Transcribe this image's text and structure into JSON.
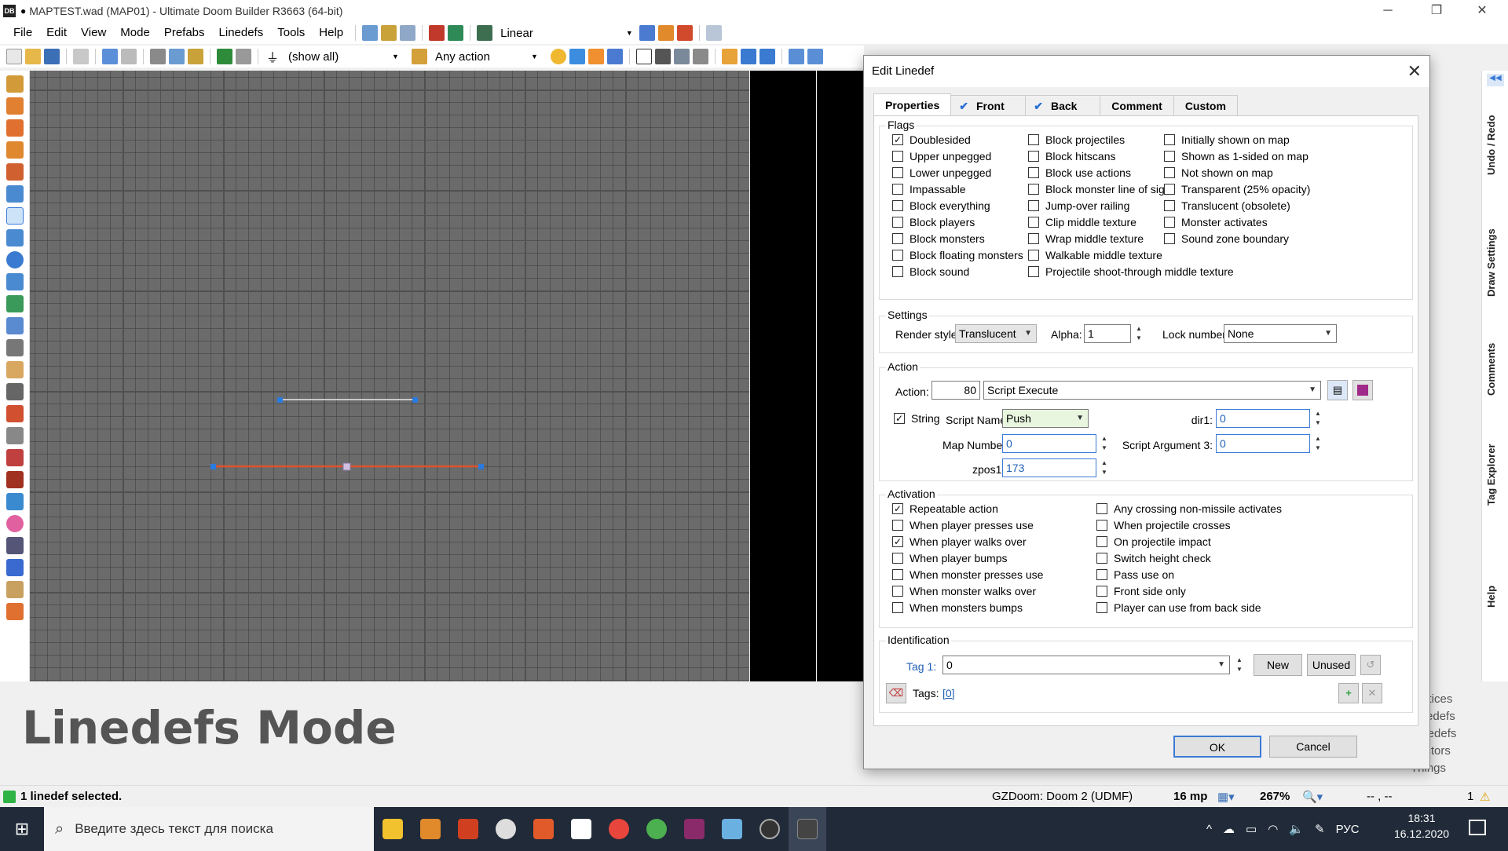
{
  "window": {
    "title": "MAPTEST.wad (MAP01) - Ultimate Doom Builder R3663 (64-bit)",
    "app_icon": "DB",
    "unsaved_marker": "●"
  },
  "menu": [
    "File",
    "Edit",
    "View",
    "Mode",
    "Prefabs",
    "Linedefs",
    "Tools",
    "Help"
  ],
  "menu_right": {
    "linear": "Linear"
  },
  "toolbar": {
    "filter": "(show all)",
    "action_filter": "Any action"
  },
  "mode_label": "Linedefs Mode",
  "side_list": [
    "Vertices",
    "Linedefs",
    "Sidedefs",
    "Sectors",
    "Things"
  ],
  "right_tabs": [
    "Undo / Redo",
    "Draw Settings",
    "Comments",
    "Tag Explorer",
    "Help"
  ],
  "status": {
    "message": "1 linedef selected.",
    "engine": "GZDoom: Doom 2 (UDMF)",
    "grid": "16 mp",
    "zoom": "267%",
    "coords": "-- , --",
    "count": "1"
  },
  "taskbar": {
    "search_placeholder": "Введите здесь текст для поиска",
    "lang": "РУС",
    "time": "18:31",
    "date": "16.12.2020"
  },
  "dialog": {
    "title": "Edit Linedef",
    "tabs": [
      {
        "label": "Properties",
        "checked": false
      },
      {
        "label": "Front",
        "checked": true
      },
      {
        "label": "Back",
        "checked": true
      },
      {
        "label": "Comment",
        "checked": false
      },
      {
        "label": "Custom",
        "checked": false
      }
    ],
    "flags_title": "Flags",
    "flags": [
      [
        {
          "label": "Doublesided",
          "checked": true
        },
        {
          "label": "Upper unpegged",
          "checked": false
        },
        {
          "label": "Lower unpegged",
          "checked": false
        },
        {
          "label": "Impassable",
          "checked": false
        },
        {
          "label": "Block everything",
          "checked": false
        },
        {
          "label": "Block players",
          "checked": false
        },
        {
          "label": "Block monsters",
          "checked": false
        },
        {
          "label": "Block floating monsters",
          "checked": false
        },
        {
          "label": "Block sound",
          "checked": false
        }
      ],
      [
        {
          "label": "Block projectiles",
          "checked": false
        },
        {
          "label": "Block hitscans",
          "checked": false
        },
        {
          "label": "Block use actions",
          "checked": false
        },
        {
          "label": "Block monster line of sight",
          "checked": false
        },
        {
          "label": "Jump-over railing",
          "checked": false
        },
        {
          "label": "Clip middle texture",
          "checked": false
        },
        {
          "label": "Wrap middle texture",
          "checked": false
        },
        {
          "label": "Walkable middle texture",
          "checked": false
        },
        {
          "label": "Projectile shoot-through middle texture",
          "checked": false
        }
      ],
      [
        {
          "label": "Initially shown on map",
          "checked": false
        },
        {
          "label": "Shown as 1-sided on map",
          "checked": false
        },
        {
          "label": "Not shown on map",
          "checked": false
        },
        {
          "label": "Transparent (25% opacity)",
          "checked": false
        },
        {
          "label": "Translucent (obsolete)",
          "checked": false
        },
        {
          "label": "Monster activates",
          "checked": false
        },
        {
          "label": "Sound zone boundary",
          "checked": false
        }
      ]
    ],
    "settings": {
      "title": "Settings",
      "render_style_label": "Render style:",
      "render_style": "Translucent",
      "alpha_label": "Alpha:",
      "alpha": "1",
      "lock_label": "Lock number:",
      "lock": "None"
    },
    "action": {
      "title": "Action",
      "action_label": "Action:",
      "number": "80",
      "name": "Script Execute",
      "string_label": "String",
      "string_checked": true,
      "script_name_label": "Script Name:",
      "script_name": "Push",
      "map_number_label": "Map Number:",
      "map_number": "0",
      "zpos1_label": "zpos1:",
      "zpos1": "173",
      "dir1_label": "dir1:",
      "dir1": "0",
      "arg3_label": "Script Argument 3:",
      "arg3": "0"
    },
    "activation_title": "Activation",
    "activation": [
      [
        {
          "label": "Repeatable action",
          "checked": true
        },
        {
          "label": "When player presses use",
          "checked": false
        },
        {
          "label": "When player walks over",
          "checked": true
        },
        {
          "label": "When player bumps",
          "checked": false
        },
        {
          "label": "When monster presses use",
          "checked": false
        },
        {
          "label": "When monster walks over",
          "checked": false
        },
        {
          "label": "When monsters bumps",
          "checked": false
        }
      ],
      [
        {
          "label": "Any crossing non-missile activates",
          "checked": false
        },
        {
          "label": "When projectile crosses",
          "checked": false
        },
        {
          "label": "On projectile impact",
          "checked": false
        },
        {
          "label": "Switch height check",
          "checked": false
        },
        {
          "label": "Pass use on",
          "checked": false
        },
        {
          "label": "Front side only",
          "checked": false
        },
        {
          "label": "Player can use from back side",
          "checked": false
        }
      ]
    ],
    "identification": {
      "title": "Identification",
      "tag_label": "Tag 1:",
      "tag": "0",
      "new": "New",
      "unused": "Unused",
      "tags_label": "Tags:",
      "tags_value": "[0]"
    },
    "ok": "OK",
    "cancel": "Cancel"
  }
}
